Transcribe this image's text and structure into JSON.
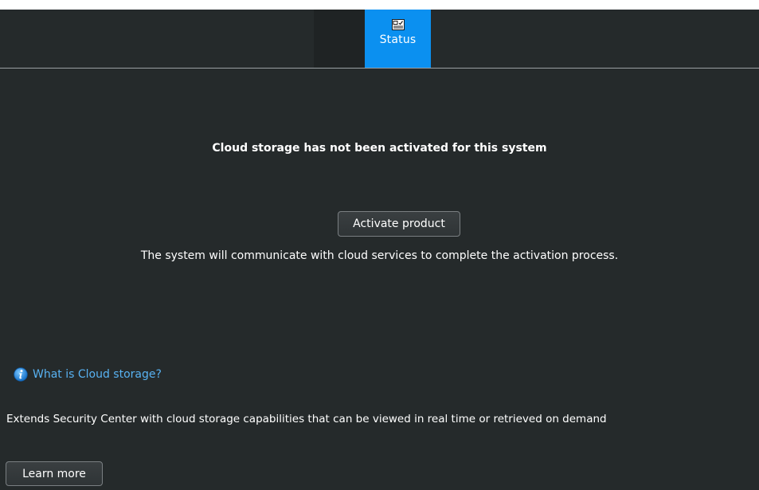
{
  "tabs": [
    {
      "label": "Status",
      "icon": "status-card-icon",
      "active": true
    }
  ],
  "colors": {
    "background": "#252a2b",
    "tab_active": "#0b90f0",
    "link": "#58b2f2",
    "text": "#ffffff"
  },
  "main": {
    "headline": "Cloud storage has not been activated for this system",
    "activate_button": "Activate product",
    "activate_description": "The system will communicate with cloud services to complete the activation process."
  },
  "info": {
    "icon": "info-icon",
    "link_text": "What is Cloud storage?",
    "description": "Extends Security Center with cloud storage capabilities that can be viewed in real time or retrieved on demand",
    "learn_more": "Learn more"
  }
}
